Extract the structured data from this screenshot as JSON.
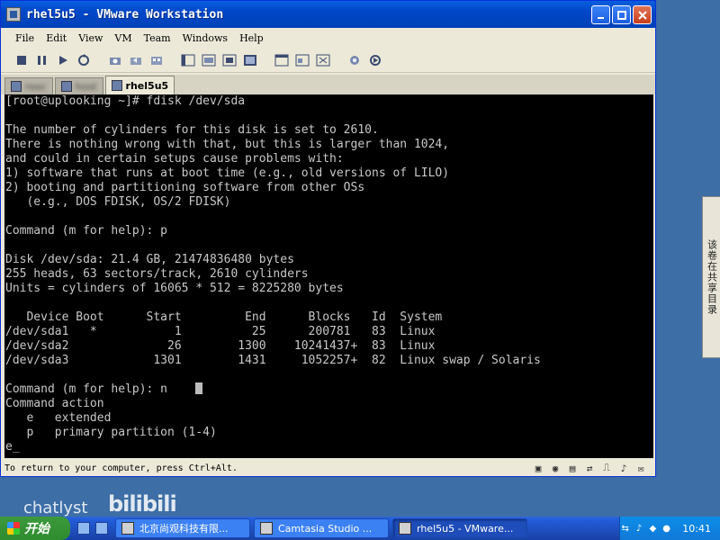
{
  "window": {
    "title": "rhel5u5 - VMware Workstation",
    "menu": [
      "File",
      "Edit",
      "View",
      "VM",
      "Team",
      "Windows",
      "Help"
    ],
    "tabs": [
      {
        "label": "rooc",
        "state": "blurred"
      },
      {
        "label": "host",
        "state": "blurred"
      },
      {
        "label": "rhel5u5",
        "state": "active"
      }
    ],
    "status_text": "To return to your computer, press Ctrl+Alt."
  },
  "console": {
    "lines": [
      "[root@uplooking ~]# fdisk /dev/sda",
      "",
      "The number of cylinders for this disk is set to 2610.",
      "There is nothing wrong with that, but this is larger than 1024,",
      "and could in certain setups cause problems with:",
      "1) software that runs at boot time (e.g., old versions of LILO)",
      "2) booting and partitioning software from other OSs",
      "   (e.g., DOS FDISK, OS/2 FDISK)",
      "",
      "Command (m for help): p",
      "",
      "Disk /dev/sda: 21.4 GB, 21474836480 bytes",
      "255 heads, 63 sectors/track, 2610 cylinders",
      "Units = cylinders of 16065 * 512 = 8225280 bytes",
      "",
      "   Device Boot      Start         End      Blocks   Id  System",
      "/dev/sda1   *           1          25      200781   83  Linux",
      "/dev/sda2              26        1300    10241437+  83  Linux",
      "/dev/sda3            1301        1431     1052257+  82  Linux swap / Solaris",
      "",
      "Command (m for help): n",
      "Command action",
      "   e   extended",
      "   p   primary partition (1-4)",
      "e"
    ]
  },
  "desktop": {
    "side_panel_text": "该卷在共享目录",
    "watermark_text": "chatlyst",
    "watermark_logo": "bilibili"
  },
  "taskbar": {
    "start_label": "开始",
    "tasks": [
      {
        "label": "北京尚观科技有限...",
        "active": false
      },
      {
        "label": "Camtasia Studio ...",
        "active": false
      },
      {
        "label": "rhel5u5 - VMware...",
        "active": true
      }
    ],
    "clock": "10:41"
  }
}
